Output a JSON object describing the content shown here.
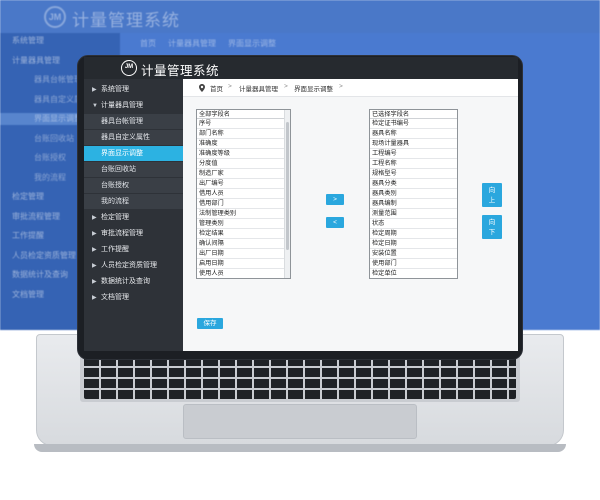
{
  "app": {
    "title": "计量管理系统",
    "logo_text": "JM"
  },
  "background": {
    "title": "计量管理系统",
    "breadcrumb": [
      "首页",
      "计量器具管理",
      "界面显示调整"
    ],
    "nav": [
      {
        "label": "系统管理",
        "level": "top"
      },
      {
        "label": "计量器具管理",
        "level": "top"
      },
      {
        "label": "器具台帐管理",
        "level": "sub"
      },
      {
        "label": "器具自定义属性",
        "level": "sub"
      },
      {
        "label": "界面显示调整",
        "level": "sub",
        "active": true
      },
      {
        "label": "台账回收站",
        "level": "sub"
      },
      {
        "label": "台账授权",
        "level": "sub"
      },
      {
        "label": "我的流程",
        "level": "sub"
      },
      {
        "label": "检定管理",
        "level": "top"
      },
      {
        "label": "审批流程管理",
        "level": "top"
      },
      {
        "label": "工作提醒",
        "level": "top"
      },
      {
        "label": "人员检定资质管理",
        "level": "top"
      },
      {
        "label": "数据统计及查询",
        "level": "top"
      },
      {
        "label": "文档管理",
        "level": "top"
      }
    ]
  },
  "sidebar": {
    "items": [
      {
        "label": "系统管理",
        "level": "top",
        "arrow": "▶"
      },
      {
        "label": "计量器具管理",
        "level": "top",
        "arrow": "▼"
      },
      {
        "label": "器具台帐管理",
        "level": "sub"
      },
      {
        "label": "器具自定义属性",
        "level": "sub"
      },
      {
        "label": "界面显示调整",
        "level": "sub",
        "active": true
      },
      {
        "label": "台账回收站",
        "level": "sub"
      },
      {
        "label": "台账授权",
        "level": "sub"
      },
      {
        "label": "我的流程",
        "level": "sub"
      },
      {
        "label": "检定管理",
        "level": "top",
        "arrow": "▶"
      },
      {
        "label": "审批流程管理",
        "level": "top",
        "arrow": "▶"
      },
      {
        "label": "工作提醒",
        "level": "top",
        "arrow": "▶"
      },
      {
        "label": "人员检定资质管理",
        "level": "top",
        "arrow": "▶"
      },
      {
        "label": "数据统计及查询",
        "level": "top",
        "arrow": "▶"
      },
      {
        "label": "文档管理",
        "level": "top",
        "arrow": "▶"
      }
    ]
  },
  "breadcrumb": {
    "items": [
      "首页",
      "计量器具管理",
      "界面显示调整"
    ],
    "separator": ">"
  },
  "all_fields": {
    "header": "全部字段名",
    "items": [
      "序号",
      "部门名称",
      "准确度",
      "准确度等级",
      "分度值",
      "制造厂家",
      "出厂编号",
      "借用人员",
      "借用部门",
      "法制管理类别",
      "管理类别",
      "检定结果",
      "确认间隔",
      "出厂日期",
      "启用日期",
      "使用人员"
    ]
  },
  "selected_fields": {
    "header": "已选择字段名",
    "items": [
      "检定证书编号",
      "器具名称",
      "现场计量器具",
      "工程编号",
      "工程名称",
      "规格型号",
      "器具分类",
      "器具类别",
      "器具编制",
      "测量范围",
      "状态",
      "检定周期",
      "检定日期",
      "安装位置",
      "使用部门",
      "检定单位"
    ]
  },
  "controls": {
    "move_right": ">",
    "move_left": "<",
    "move_up": "向上",
    "move_down": "向下",
    "save": "保存"
  },
  "colors": {
    "accent": "#2aa7de",
    "active_nav": "#2cb2e2",
    "header": "#262a2f",
    "sidebar": "#2e3238",
    "background_blue": "#3b6bc0"
  },
  "icons": [
    "location-pin-icon",
    "chevron-right-icon",
    "chevron-down-icon"
  ]
}
